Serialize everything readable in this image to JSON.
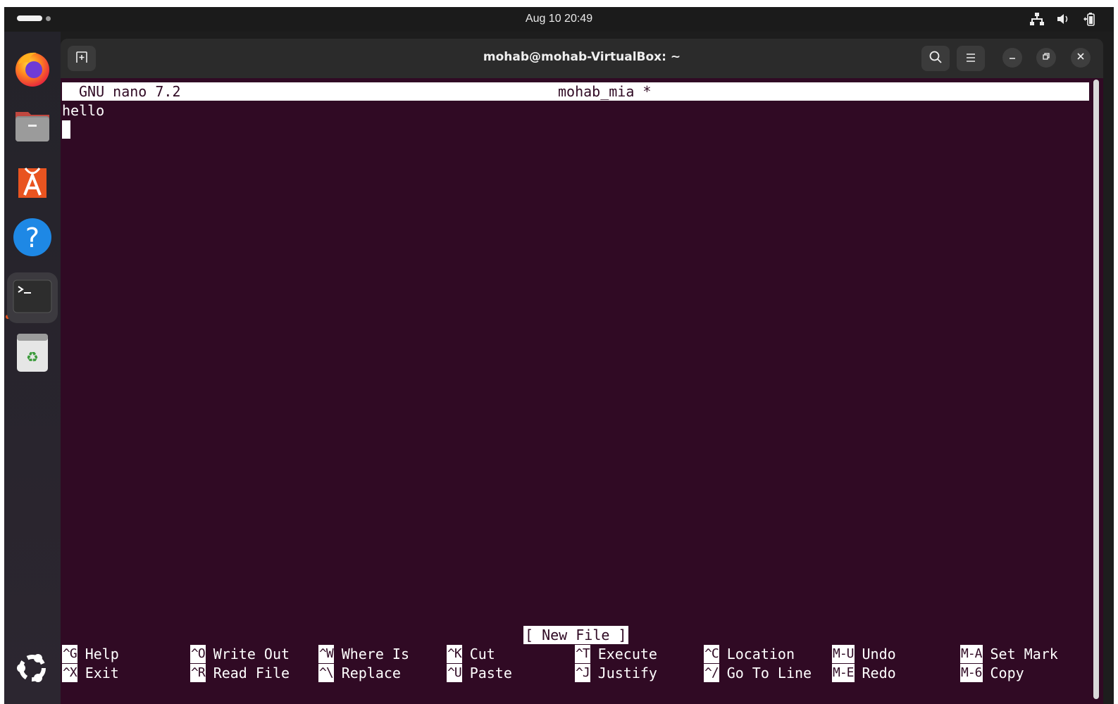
{
  "topbar": {
    "clock": "Aug 10  20:49"
  },
  "dock": {
    "items": [
      "Firefox",
      "Files",
      "App Center",
      "Help",
      "Terminal",
      "Trash",
      "Show Apps"
    ]
  },
  "window": {
    "title": "mohab@mohab-VirtualBox: ~"
  },
  "nano": {
    "version": "GNU nano 7.2",
    "filename": "mohab_mia *",
    "lines": [
      "hello"
    ],
    "status": "[ New File ]",
    "shortcuts_row1": [
      {
        "key": "^G",
        "label": "Help"
      },
      {
        "key": "^O",
        "label": "Write Out"
      },
      {
        "key": "^W",
        "label": "Where Is"
      },
      {
        "key": "^K",
        "label": "Cut"
      },
      {
        "key": "^T",
        "label": "Execute"
      },
      {
        "key": "^C",
        "label": "Location"
      },
      {
        "key": "M-U",
        "label": "Undo"
      },
      {
        "key": "M-A",
        "label": "Set Mark"
      }
    ],
    "shortcuts_row2": [
      {
        "key": "^X",
        "label": "Exit"
      },
      {
        "key": "^R",
        "label": "Read File"
      },
      {
        "key": "^\\",
        "label": "Replace"
      },
      {
        "key": "^U",
        "label": "Paste"
      },
      {
        "key": "^J",
        "label": "Justify"
      },
      {
        "key": "^/",
        "label": "Go To Line"
      },
      {
        "key": "M-E",
        "label": "Redo"
      },
      {
        "key": "M-6",
        "label": "Copy"
      }
    ]
  },
  "colors": {
    "terminal_bg": "#300a24",
    "accent": "#e95420"
  }
}
